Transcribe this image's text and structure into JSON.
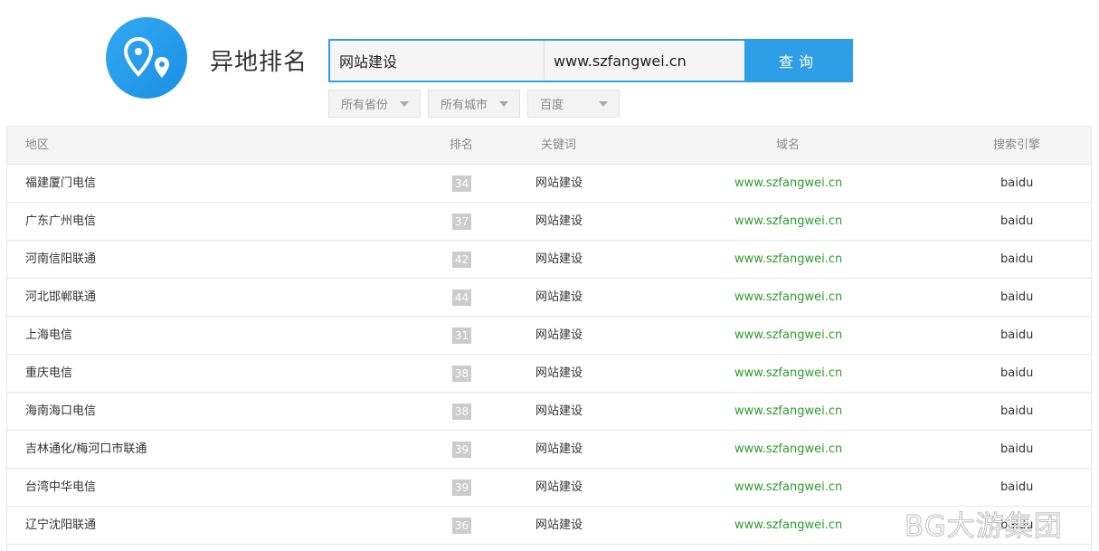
{
  "header": {
    "title": "异地排名",
    "search": {
      "keyword_value": "网站建设",
      "domain_value": "www.szfangwei.cn",
      "button_label": "查询"
    },
    "filters": [
      {
        "label": "所有省份"
      },
      {
        "label": "所有城市"
      },
      {
        "label": "百度"
      }
    ]
  },
  "colors": {
    "accent": "#2e9ee6",
    "domain_green": "#2c9d2c",
    "rank_badge": "#cccccc"
  },
  "table": {
    "columns": [
      "地区",
      "排名",
      "关键词",
      "域名",
      "搜索引擎"
    ],
    "rows": [
      {
        "region": "福建厦门电信",
        "rank": "34",
        "keyword": "网站建设",
        "domain": "www.szfangwei.cn",
        "engine": "baidu"
      },
      {
        "region": "广东广州电信",
        "rank": "37",
        "keyword": "网站建设",
        "domain": "www.szfangwei.cn",
        "engine": "baidu"
      },
      {
        "region": "河南信阳联通",
        "rank": "42",
        "keyword": "网站建设",
        "domain": "www.szfangwei.cn",
        "engine": "baidu"
      },
      {
        "region": "河北邯郸联通",
        "rank": "44",
        "keyword": "网站建设",
        "domain": "www.szfangwei.cn",
        "engine": "baidu"
      },
      {
        "region": "上海电信",
        "rank": "31",
        "keyword": "网站建设",
        "domain": "www.szfangwei.cn",
        "engine": "baidu"
      },
      {
        "region": "重庆电信",
        "rank": "38",
        "keyword": "网站建设",
        "domain": "www.szfangwei.cn",
        "engine": "baidu"
      },
      {
        "region": "海南海口电信",
        "rank": "38",
        "keyword": "网站建设",
        "domain": "www.szfangwei.cn",
        "engine": "baidu"
      },
      {
        "region": "吉林通化/梅河口市联通",
        "rank": "39",
        "keyword": "网站建设",
        "domain": "www.szfangwei.cn",
        "engine": "baidu"
      },
      {
        "region": "台湾中华电信",
        "rank": "39",
        "keyword": "网站建设",
        "domain": "www.szfangwei.cn",
        "engine": "baidu"
      },
      {
        "region": "辽宁沈阳联通",
        "rank": "36",
        "keyword": "网站建设",
        "domain": "www.szfangwei.cn",
        "engine": "baidu"
      }
    ]
  },
  "watermark": "BG大游集团"
}
